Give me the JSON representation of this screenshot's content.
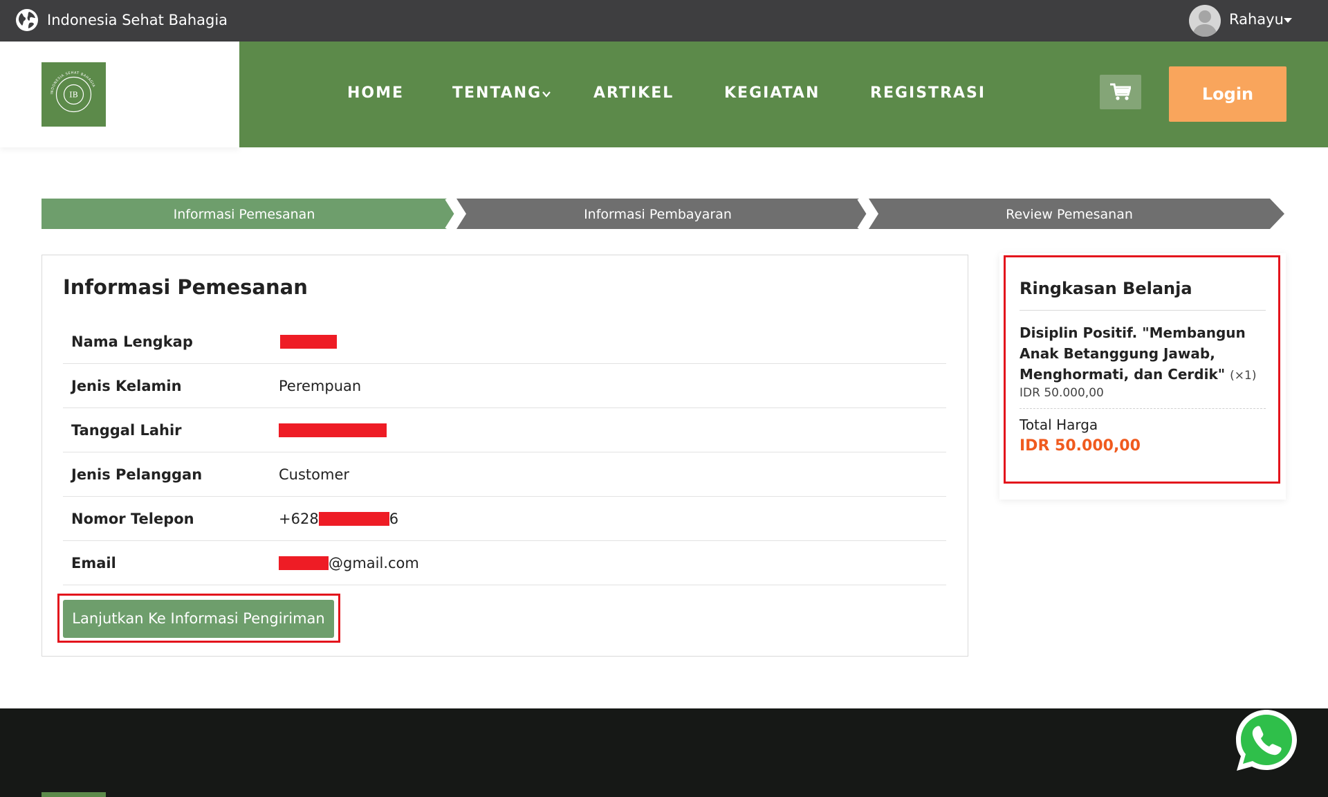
{
  "topbar": {
    "site_name": "Indonesia Sehat Bahagia",
    "globe_icon": "globe-icon",
    "user_name": "Rahayu",
    "user_caret_icon": "caret-down-icon",
    "avatar_icon": "user-avatar-icon"
  },
  "header": {
    "logo_monogram": "IB",
    "logo_ring_text": "INDONESIA SEHAT BAHAGIA",
    "nav": [
      {
        "label": "HOME"
      },
      {
        "label": "TENTANG"
      },
      {
        "label": "ARTIKEL"
      },
      {
        "label": "KEGIATAN"
      },
      {
        "label": "REGISTRASI"
      }
    ],
    "tentang_chevron_icon": "chevron-down-icon",
    "cart_icon": "shopping-cart-icon",
    "login_label": "Login",
    "colors": {
      "header_green": "#5c8a4a",
      "login_orange": "#f9a55c",
      "cart_bg": "#84a577"
    }
  },
  "steps": [
    {
      "label": "Informasi Pemesanan",
      "active": true
    },
    {
      "label": "Informasi Pembayaran",
      "active": false
    },
    {
      "label": "Review Pemesanan",
      "active": false
    }
  ],
  "steps_colors": {
    "active": "#6e9e6c",
    "inactive": "#6f6f6f"
  },
  "order_info": {
    "title": "Informasi Pemesanan",
    "rows": [
      {
        "label": "Nama Lengkap",
        "value": ""
      },
      {
        "label": "Jenis Kelamin",
        "value": "Perempuan"
      },
      {
        "label": "Tanggal Lahir",
        "value": ""
      },
      {
        "label": "Jenis Pelanggan",
        "value": "Customer"
      },
      {
        "label": "Nomor Telepon",
        "value_prefix": "+628",
        "value_suffix": "6"
      },
      {
        "label": "Email",
        "value_suffix": "@gmail.com"
      }
    ],
    "continue_label": "Lanjutkan Ke Informasi Pengiriman"
  },
  "summary": {
    "title": "Ringkasan Belanja",
    "item_name": "Disiplin Positif. \"Membangun Anak Betanggung Jawab, Menghormati, dan Cerdik\"",
    "item_qty": "(×1)",
    "item_price": "IDR 50.000,00",
    "total_label": "Total Harga",
    "total_value": "IDR 50.000,00",
    "total_color": "#f05a1e"
  },
  "floating": {
    "whatsapp_icon": "whatsapp-icon"
  },
  "annotation_color": "#e3141c",
  "redaction_color": "#ee1c25"
}
